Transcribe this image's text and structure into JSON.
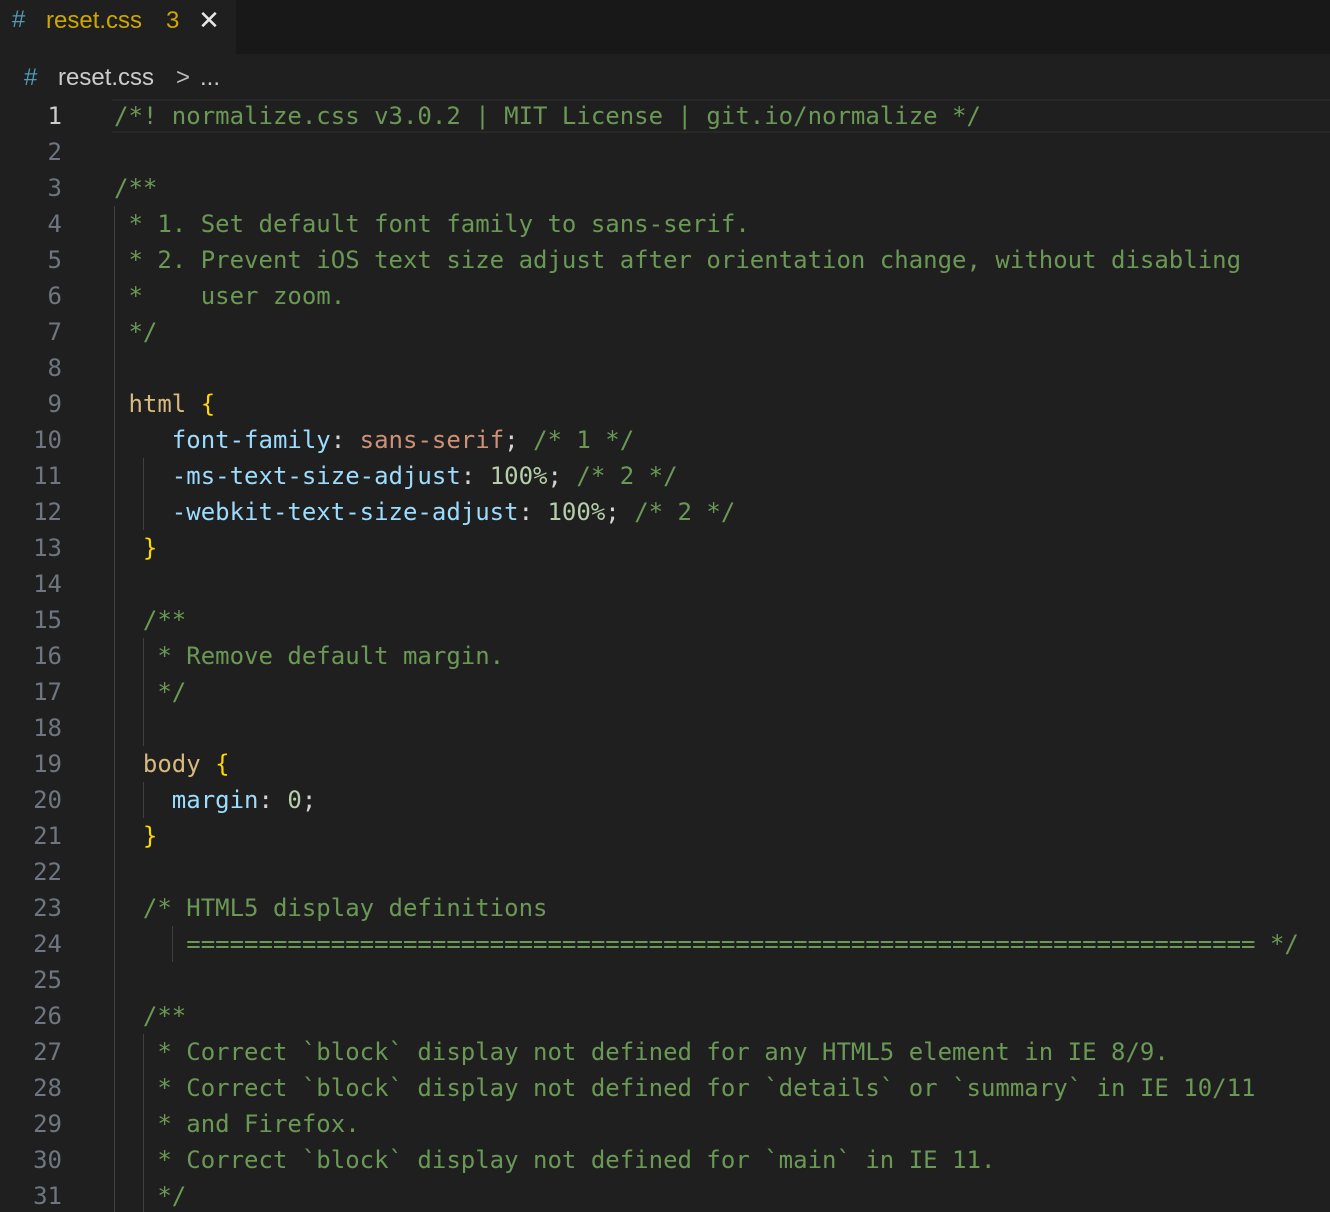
{
  "tab": {
    "icon": "css-hash-icon",
    "hash": "#",
    "filename": "reset.css",
    "problem_count": "3",
    "close_icon": "close-icon"
  },
  "breadcrumb": {
    "hash": "#",
    "file": "reset.css",
    "separator": ">",
    "more": "..."
  },
  "editor": {
    "current_line": 1,
    "lines": [
      {
        "n": "1",
        "parts": [
          {
            "t": "/*! normalize.css v3.0.2 | MIT License | git.io/normalize */",
            "c": "comment"
          }
        ]
      },
      {
        "n": "2",
        "parts": []
      },
      {
        "n": "3",
        "parts": [
          {
            "t": "/**",
            "c": "comment"
          }
        ]
      },
      {
        "n": "4",
        "parts": [
          {
            "t": " * 1. Set default font family to sans-serif.",
            "c": "comment"
          }
        ]
      },
      {
        "n": "5",
        "parts": [
          {
            "t": " * 2. Prevent iOS text size adjust after orientation change, without disabling",
            "c": "comment"
          }
        ]
      },
      {
        "n": "6",
        "parts": [
          {
            "t": " *    user zoom.",
            "c": "comment"
          }
        ]
      },
      {
        "n": "7",
        "parts": [
          {
            "t": " */",
            "c": "comment"
          }
        ]
      },
      {
        "n": "8",
        "parts": []
      },
      {
        "n": "9",
        "parts": [
          {
            "t": " html",
            "c": "sel"
          },
          {
            "t": " ",
            "c": "punc"
          },
          {
            "t": "{",
            "c": "brace"
          }
        ]
      },
      {
        "n": "10",
        "parts": [
          {
            "t": "    font-family",
            "c": "prop"
          },
          {
            "t": ": ",
            "c": "punc"
          },
          {
            "t": "sans-serif",
            "c": "val"
          },
          {
            "t": "; ",
            "c": "punc"
          },
          {
            "t": "/* 1 */",
            "c": "comment"
          }
        ]
      },
      {
        "n": "11",
        "parts": [
          {
            "t": "    -ms-text-size-adjust",
            "c": "prop"
          },
          {
            "t": ": ",
            "c": "punc"
          },
          {
            "t": "100%",
            "c": "num"
          },
          {
            "t": "; ",
            "c": "punc"
          },
          {
            "t": "/* 2 */",
            "c": "comment"
          }
        ]
      },
      {
        "n": "12",
        "parts": [
          {
            "t": "    -webkit-text-size-adjust",
            "c": "prop"
          },
          {
            "t": ": ",
            "c": "punc"
          },
          {
            "t": "100%",
            "c": "num"
          },
          {
            "t": "; ",
            "c": "punc"
          },
          {
            "t": "/* 2 */",
            "c": "comment"
          }
        ]
      },
      {
        "n": "13",
        "parts": [
          {
            "t": "  }",
            "c": "brace"
          }
        ]
      },
      {
        "n": "14",
        "parts": []
      },
      {
        "n": "15",
        "parts": [
          {
            "t": "  /**",
            "c": "comment"
          }
        ]
      },
      {
        "n": "16",
        "parts": [
          {
            "t": "   * Remove default margin.",
            "c": "comment"
          }
        ]
      },
      {
        "n": "17",
        "parts": [
          {
            "t": "   */",
            "c": "comment"
          }
        ]
      },
      {
        "n": "18",
        "parts": []
      },
      {
        "n": "19",
        "parts": [
          {
            "t": "  body",
            "c": "sel"
          },
          {
            "t": " ",
            "c": "punc"
          },
          {
            "t": "{",
            "c": "brace"
          }
        ]
      },
      {
        "n": "20",
        "parts": [
          {
            "t": "    margin",
            "c": "prop"
          },
          {
            "t": ": ",
            "c": "punc"
          },
          {
            "t": "0",
            "c": "num"
          },
          {
            "t": ";",
            "c": "punc"
          }
        ]
      },
      {
        "n": "21",
        "parts": [
          {
            "t": "  }",
            "c": "brace"
          }
        ]
      },
      {
        "n": "22",
        "parts": []
      },
      {
        "n": "23",
        "parts": [
          {
            "t": "  /* HTML5 display definitions",
            "c": "comment"
          }
        ]
      },
      {
        "n": "24",
        "parts": [
          {
            "t": "     ========================================================================== */",
            "c": "comment"
          }
        ]
      },
      {
        "n": "25",
        "parts": []
      },
      {
        "n": "26",
        "parts": [
          {
            "t": "  /**",
            "c": "comment"
          }
        ]
      },
      {
        "n": "27",
        "parts": [
          {
            "t": "   * Correct `block` display not defined for any HTML5 element in IE 8/9.",
            "c": "comment"
          }
        ]
      },
      {
        "n": "28",
        "parts": [
          {
            "t": "   * Correct `block` display not defined for `details` or `summary` in IE 10/11",
            "c": "comment"
          }
        ]
      },
      {
        "n": "29",
        "parts": [
          {
            "t": "   * and Firefox.",
            "c": "comment"
          }
        ]
      },
      {
        "n": "30",
        "parts": [
          {
            "t": "   * Correct `block` display not defined for `main` in IE 11.",
            "c": "comment"
          }
        ]
      },
      {
        "n": "31",
        "parts": [
          {
            "t": "   */",
            "c": "comment"
          }
        ]
      }
    ]
  }
}
